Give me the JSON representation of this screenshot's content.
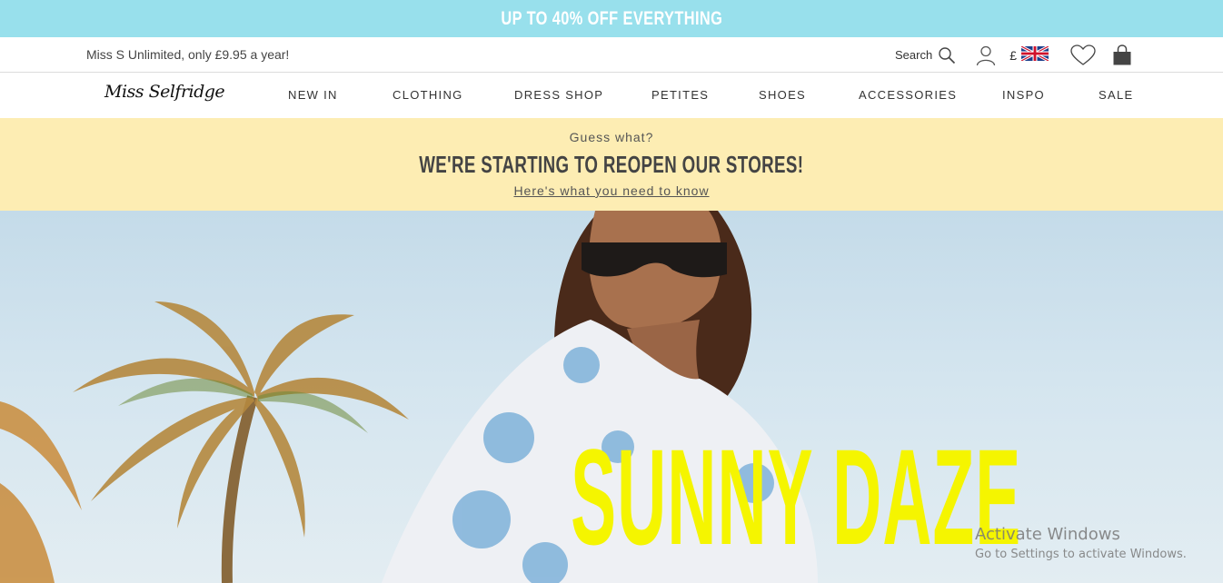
{
  "promo": {
    "text": "UP TO 40% OFF EVERYTHING"
  },
  "utility": {
    "offer": "Miss S Unlimited, only £9.95 a year!",
    "search_label": "Search",
    "currency_symbol": "£"
  },
  "nav": {
    "logo": "Miss Selfridge",
    "items": [
      {
        "label": "NEW IN"
      },
      {
        "label": "CLOTHING"
      },
      {
        "label": "DRESS SHOP"
      },
      {
        "label": "PETITES"
      },
      {
        "label": "SHOES"
      },
      {
        "label": "ACCESSORIES"
      },
      {
        "label": "INSPO"
      },
      {
        "label": "SALE"
      }
    ]
  },
  "notice": {
    "kicker": "Guess what?",
    "headline": "WE'RE STARTING TO REOPEN OUR STORES!",
    "link": "Here's what you need to know"
  },
  "hero": {
    "title": "SUNNY DAZE"
  },
  "windows_watermark": {
    "line1": "Activate Windows",
    "line2": "Go to Settings to activate Windows."
  },
  "colors": {
    "promo_bg": "#98e0ec",
    "notice_bg": "#fdedb3",
    "hero_title": "#f5f500"
  },
  "icons": [
    "search-icon",
    "account-icon",
    "uk-flag-icon",
    "wishlist-heart-icon",
    "shopping-bag-icon"
  ]
}
